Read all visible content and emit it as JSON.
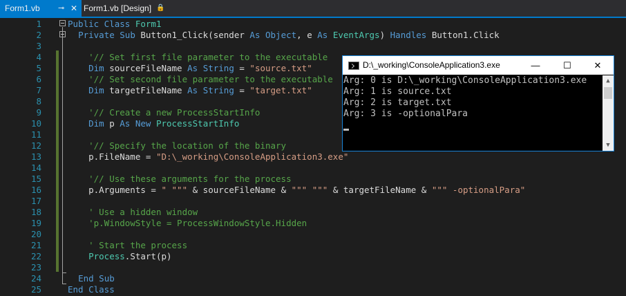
{
  "tabs": [
    {
      "label": "Form1.vb",
      "pin_icon": "⊸",
      "close_icon": "✕"
    },
    {
      "label": "Form1.vb [Design]",
      "lock_icon": "🔒"
    }
  ],
  "editor": {
    "lines": [
      {
        "n": "1",
        "tokens": [
          {
            "t": "Public Class ",
            "c": "kw"
          },
          {
            "t": "Form1",
            "c": "ty"
          }
        ]
      },
      {
        "n": "2",
        "tokens": [
          {
            "t": "  "
          },
          {
            "t": "Private Sub ",
            "c": "kw"
          },
          {
            "t": "Button1_Click(sender "
          },
          {
            "t": "As ",
            "c": "kw"
          },
          {
            "t": "Object",
            "c": "kw"
          },
          {
            "t": ", e "
          },
          {
            "t": "As ",
            "c": "kw"
          },
          {
            "t": "EventArgs",
            "c": "ty"
          },
          {
            "t": ") "
          },
          {
            "t": "Handles ",
            "c": "kw"
          },
          {
            "t": "Button1.Click"
          }
        ]
      },
      {
        "n": "3",
        "tokens": []
      },
      {
        "n": "4",
        "tokens": [
          {
            "t": "    "
          },
          {
            "t": "'// Set first file parameter to the executable",
            "c": "cm"
          }
        ]
      },
      {
        "n": "5",
        "tokens": [
          {
            "t": "    "
          },
          {
            "t": "Dim ",
            "c": "kw"
          },
          {
            "t": "sourceFileName "
          },
          {
            "t": "As ",
            "c": "kw"
          },
          {
            "t": "String",
            "c": "kw"
          },
          {
            "t": " = "
          },
          {
            "t": "\"source.txt\"",
            "c": "str"
          }
        ]
      },
      {
        "n": "6",
        "tokens": [
          {
            "t": "    "
          },
          {
            "t": "'// Set second file parameter to the executable",
            "c": "cm"
          }
        ]
      },
      {
        "n": "7",
        "tokens": [
          {
            "t": "    "
          },
          {
            "t": "Dim ",
            "c": "kw"
          },
          {
            "t": "targetFileName "
          },
          {
            "t": "As ",
            "c": "kw"
          },
          {
            "t": "String",
            "c": "kw"
          },
          {
            "t": " = "
          },
          {
            "t": "\"target.txt\"",
            "c": "str"
          }
        ]
      },
      {
        "n": "8",
        "tokens": []
      },
      {
        "n": "9",
        "tokens": [
          {
            "t": "    "
          },
          {
            "t": "'// Create a new ProcessStartInfo",
            "c": "cm"
          }
        ]
      },
      {
        "n": "10",
        "tokens": [
          {
            "t": "    "
          },
          {
            "t": "Dim ",
            "c": "kw"
          },
          {
            "t": "p "
          },
          {
            "t": "As New ",
            "c": "kw"
          },
          {
            "t": "ProcessStartInfo",
            "c": "ty"
          }
        ]
      },
      {
        "n": "11",
        "tokens": []
      },
      {
        "n": "12",
        "tokens": [
          {
            "t": "    "
          },
          {
            "t": "'// Specify the location of the binary",
            "c": "cm"
          }
        ]
      },
      {
        "n": "13",
        "tokens": [
          {
            "t": "    p.FileName = "
          },
          {
            "t": "\"D:\\_working\\ConsoleApplication3.exe\"",
            "c": "str"
          }
        ]
      },
      {
        "n": "14",
        "tokens": []
      },
      {
        "n": "15",
        "tokens": [
          {
            "t": "    "
          },
          {
            "t": "'// Use these arguments for the process",
            "c": "cm"
          }
        ]
      },
      {
        "n": "16",
        "tokens": [
          {
            "t": "    p.Arguments = "
          },
          {
            "t": "\" \"\"\"",
            "c": "str"
          },
          {
            "t": " & sourceFileName & "
          },
          {
            "t": "\"\"\" \"\"\"",
            "c": "str"
          },
          {
            "t": " & targetFileName & "
          },
          {
            "t": "\"\"\" -optionalPara\"",
            "c": "str"
          }
        ]
      },
      {
        "n": "17",
        "tokens": []
      },
      {
        "n": "18",
        "tokens": [
          {
            "t": "    "
          },
          {
            "t": "' Use a hidden window",
            "c": "cm"
          }
        ]
      },
      {
        "n": "19",
        "tokens": [
          {
            "t": "    "
          },
          {
            "t": "'p.WindowStyle = ProcessWindowStyle.Hidden",
            "c": "cm"
          }
        ]
      },
      {
        "n": "20",
        "tokens": []
      },
      {
        "n": "21",
        "tokens": [
          {
            "t": "    "
          },
          {
            "t": "' Start the process",
            "c": "cm"
          }
        ]
      },
      {
        "n": "22",
        "tokens": [
          {
            "t": "    "
          },
          {
            "t": "Process",
            "c": "ty"
          },
          {
            "t": ".Start(p)"
          }
        ]
      },
      {
        "n": "23",
        "tokens": []
      },
      {
        "n": "24",
        "tokens": [
          {
            "t": "  "
          },
          {
            "t": "End Sub",
            "c": "kw"
          }
        ]
      },
      {
        "n": "25",
        "tokens": [
          {
            "t": "End Class",
            "c": "kw"
          }
        ]
      }
    ]
  },
  "console": {
    "title": "D:\\_working\\ConsoleApplication3.exe",
    "minimize_icon": "—",
    "maximize_icon": "☐",
    "close_icon": "✕",
    "output": [
      "Arg: 0 is D:\\_working\\ConsoleApplication3.exe",
      "Arg: 1 is source.txt",
      "Arg: 2 is target.txt",
      "Arg: 3 is -optionalPara"
    ],
    "scroll_up_icon": "▲",
    "scroll_down_icon": "▼"
  },
  "colors": {
    "accent": "#007acc",
    "keyword": "#569cd6",
    "type": "#4ec9b0",
    "string": "#d69d85",
    "comment": "#57a64a",
    "line_number": "#2b91af"
  }
}
